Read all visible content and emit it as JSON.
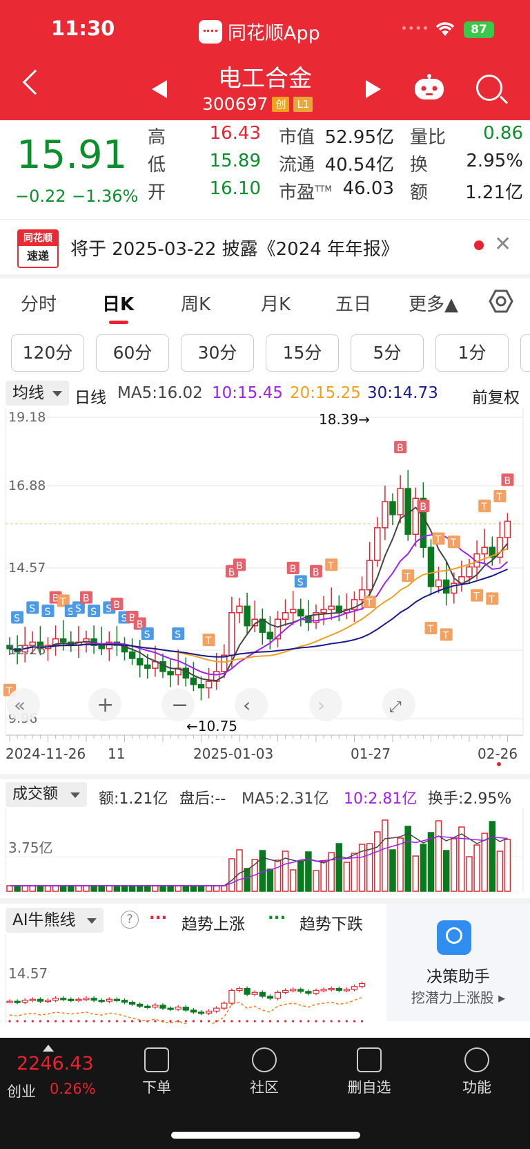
{
  "status": {
    "time": "11:30",
    "app_name": "同花顺App",
    "battery": "87"
  },
  "stock": {
    "name": "电工合金",
    "code": "300697",
    "tags": [
      "创",
      "L1"
    ]
  },
  "quote": {
    "price": "15.91",
    "change": "−0.22",
    "change_pct": "−1.36%",
    "rows": [
      {
        "l1": "高",
        "v1": "16.43",
        "l2": "市值",
        "v2": "52.95亿",
        "l3": "量比",
        "v3": "0.86"
      },
      {
        "l1": "低",
        "v1": "15.89",
        "l2": "流通",
        "v2": "40.54亿",
        "l3": "换",
        "v3": "2.95%"
      },
      {
        "l1": "开",
        "v1": "16.10",
        "l2": "市盈",
        "l2sup": "TTM",
        "v2": "46.03",
        "l3": "额",
        "v3": "1.21亿"
      }
    ]
  },
  "news": {
    "logo_top": "同花顺",
    "logo_bottom": "速递",
    "text": "将于 2025-03-22 披露《2024 年年报》"
  },
  "tabs": [
    "分时",
    "日K",
    "周K",
    "月K",
    "五日",
    "更多▲"
  ],
  "minute_buttons": [
    "120分",
    "60分",
    "30分",
    "15分",
    "5分",
    "1分"
  ],
  "ma_line": {
    "selector": "均线",
    "period": "日线",
    "ma5": "MA5:16.02",
    "ma10": "10:15.45",
    "ma20": "20:15.25",
    "ma30": "30:14.73",
    "adjust": "前复权"
  },
  "kline": {
    "y_ticks": [
      "19.18",
      "16.88",
      "14.57",
      "12.26",
      "9.96"
    ],
    "high_label": "18.39→",
    "low_label": "←10.75",
    "dates": [
      "2024-11-26",
      "11",
      "2025-01-03",
      "01-27",
      "02-26"
    ],
    "colors": {
      "up": "#e8232f",
      "down": "#0a7a1f",
      "ma5": "#444444",
      "ma10": "#a020f0",
      "ma20": "#f0a020",
      "ma30": "#1a1a8a"
    }
  },
  "volume": {
    "selector": "成交额",
    "amount": "额:1.21亿",
    "after": "盘后:--",
    "ma5": "MA5:2.31亿",
    "ma10": "10:2.81亿",
    "turnover": "换手:2.95%",
    "y_tick": "3.75亿"
  },
  "ai": {
    "selector": "AI牛熊线",
    "help": "?",
    "up_label": "趋势上涨",
    "down_label": "趋势下跌",
    "y_tick": "14.57",
    "assistant_title": "决策助手",
    "assistant_sub": "挖潜力上涨股 ▸"
  },
  "bottom": {
    "index_value": "2246.43",
    "index_name": "创业",
    "index_pct": "0.26%",
    "tabs": [
      "下单",
      "社区",
      "删自选",
      "功能"
    ]
  }
}
